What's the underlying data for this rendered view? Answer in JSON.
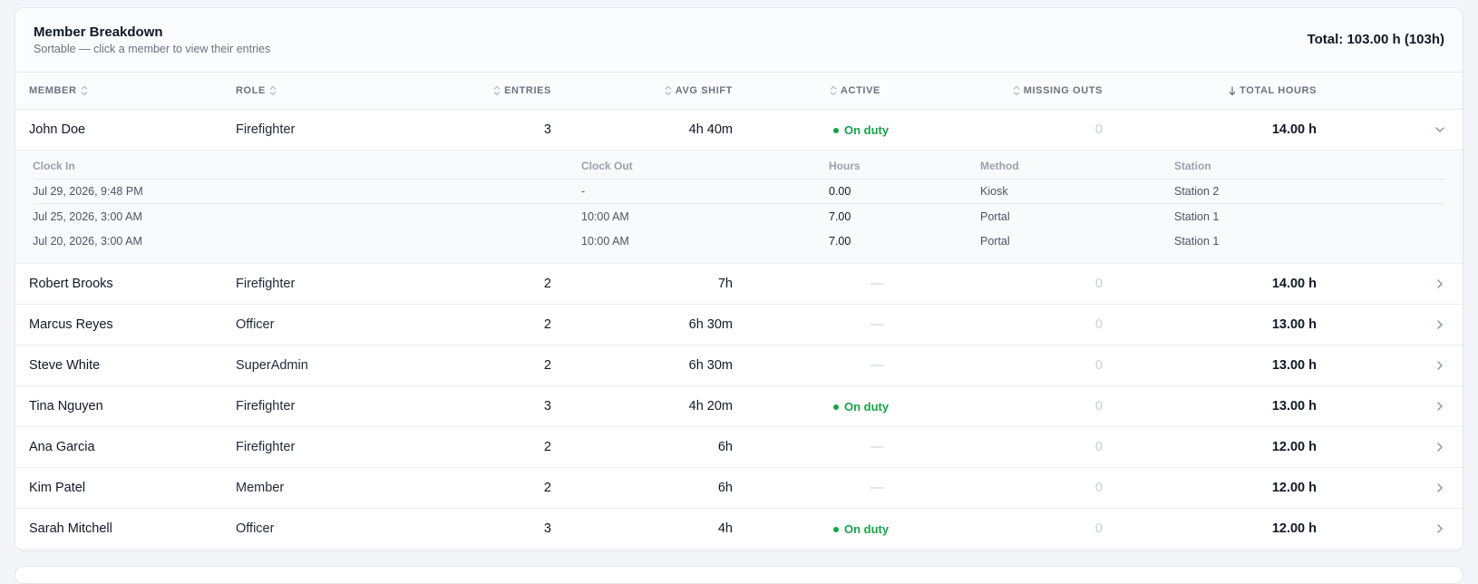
{
  "header": {
    "title": "Member Breakdown",
    "subtitle": "Sortable — click a member to view their entries",
    "total": "Total: 103.00 h (103h)"
  },
  "columns": {
    "member": "MEMBER",
    "role": "ROLE",
    "entries": "ENTRIES",
    "avg_shift": "AVG SHIFT",
    "active": "ACTIVE",
    "missing_outs": "MISSING OUTS",
    "total_hours": "TOTAL HOURS"
  },
  "rows": [
    {
      "member": "John Doe",
      "role": "Firefighter",
      "entries": "3",
      "avg_shift": "4h 40m",
      "active": "On duty",
      "missing_outs": "0",
      "total_hours": "14.00 h"
    },
    {
      "member": "Robert Brooks",
      "role": "Firefighter",
      "entries": "2",
      "avg_shift": "7h",
      "active": "—",
      "missing_outs": "0",
      "total_hours": "14.00 h"
    },
    {
      "member": "Marcus Reyes",
      "role": "Officer",
      "entries": "2",
      "avg_shift": "6h 30m",
      "active": "—",
      "missing_outs": "0",
      "total_hours": "13.00 h"
    },
    {
      "member": "Steve White",
      "role": "SuperAdmin",
      "entries": "2",
      "avg_shift": "6h 30m",
      "active": "—",
      "missing_outs": "0",
      "total_hours": "13.00 h"
    },
    {
      "member": "Tina Nguyen",
      "role": "Firefighter",
      "entries": "3",
      "avg_shift": "4h 20m",
      "active": "On duty",
      "missing_outs": "0",
      "total_hours": "13.00 h"
    },
    {
      "member": "Ana Garcia",
      "role": "Firefighter",
      "entries": "2",
      "avg_shift": "6h",
      "active": "—",
      "missing_outs": "0",
      "total_hours": "12.00 h"
    },
    {
      "member": "Kim Patel",
      "role": "Member",
      "entries": "2",
      "avg_shift": "6h",
      "active": "—",
      "missing_outs": "0",
      "total_hours": "12.00 h"
    },
    {
      "member": "Sarah Mitchell",
      "role": "Officer",
      "entries": "3",
      "avg_shift": "4h",
      "active": "On duty",
      "missing_outs": "0",
      "total_hours": "12.00 h"
    }
  ],
  "detail": {
    "columns": {
      "clock_in": "Clock In",
      "clock_out": "Clock Out",
      "hours": "Hours",
      "method": "Method",
      "station": "Station"
    },
    "entries": [
      {
        "clock_in": "Jul 29, 2026, 9:48 PM",
        "clock_out": "-",
        "hours": "0.00",
        "method": "Kiosk",
        "station": "Station 2"
      },
      {
        "clock_in": "Jul 25, 2026, 3:00 AM",
        "clock_out": "10:00 AM",
        "hours": "7.00",
        "method": "Portal",
        "station": "Station 1"
      },
      {
        "clock_in": "Jul 20, 2026, 3:00 AM",
        "clock_out": "10:00 AM",
        "hours": "7.00",
        "method": "Portal",
        "station": "Station 1"
      }
    ]
  },
  "colors": {
    "accent_green": "#16a34a",
    "muted": "#6b7280",
    "border": "#e5e8ed"
  }
}
